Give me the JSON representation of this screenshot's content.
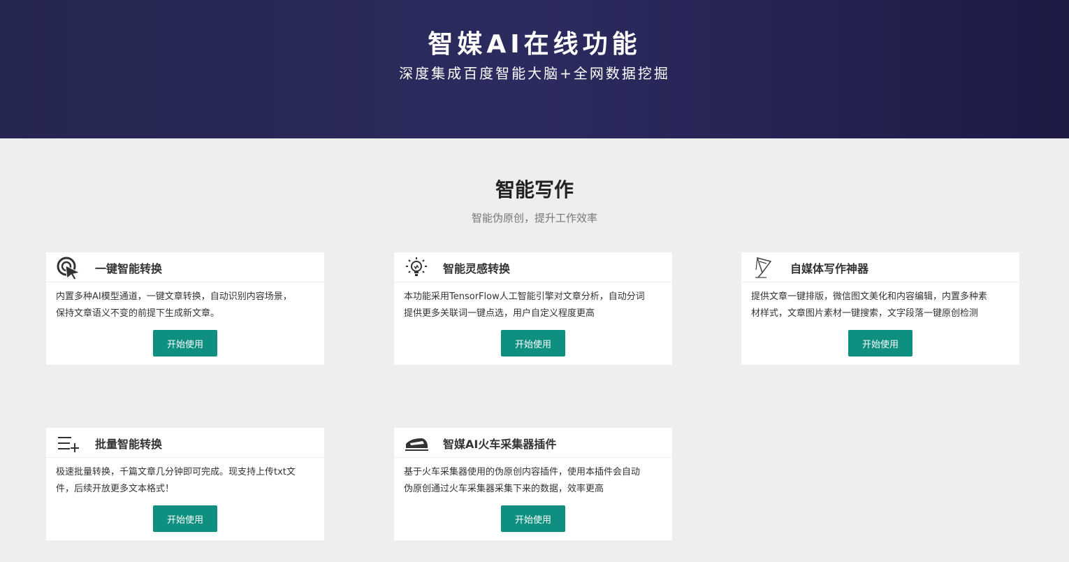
{
  "hero": {
    "title": "智媒AI在线功能",
    "subtitle": "深度集成百度智能大脑+全网数据挖掘"
  },
  "section": {
    "title": "智能写作",
    "subtitle": "智能伪原创，提升工作效率"
  },
  "colors": {
    "hero_bg": "#28285a",
    "page_bg": "#eeeeee",
    "button": "#0e8f7f"
  },
  "cards": [
    {
      "icon": "cursor-target-icon",
      "title": "一键智能转换",
      "desc": "内置多种AI模型通道，一键文章转换，自动识别内容场景，\n保持文章语义不变的前提下生成新文章。",
      "button": "开始使用"
    },
    {
      "icon": "lightbulb-icon",
      "title": "智能灵感转换",
      "desc": "本功能采用TensorFlow人工智能引擎对文章分析，自动分词\n提供更多关联词一键点选，用户自定义程度更高",
      "button": "开始使用"
    },
    {
      "icon": "pen-nib-icon",
      "title": "自媒体写作神器",
      "desc": "提供文章一键排版，微信图文美化和内容编辑，内置多种素\n材样式，文章图片素材一键搜索，文字段落一键原创检测",
      "button": "开始使用"
    },
    {
      "icon": "list-add-icon",
      "title": "批量智能转换",
      "desc": "极速批量转换，千篇文章几分钟即可完成。现支持上传txt文\n件，后续开放更多文本格式！",
      "button": "开始使用"
    },
    {
      "icon": "train-icon",
      "title": "智媒AI火车采集器插件",
      "desc": "基于火车采集器使用的伪原创内容插件，使用本插件会自动\n伪原创通过火车采集器采集下来的数据，效率更高",
      "button": "开始使用"
    }
  ]
}
